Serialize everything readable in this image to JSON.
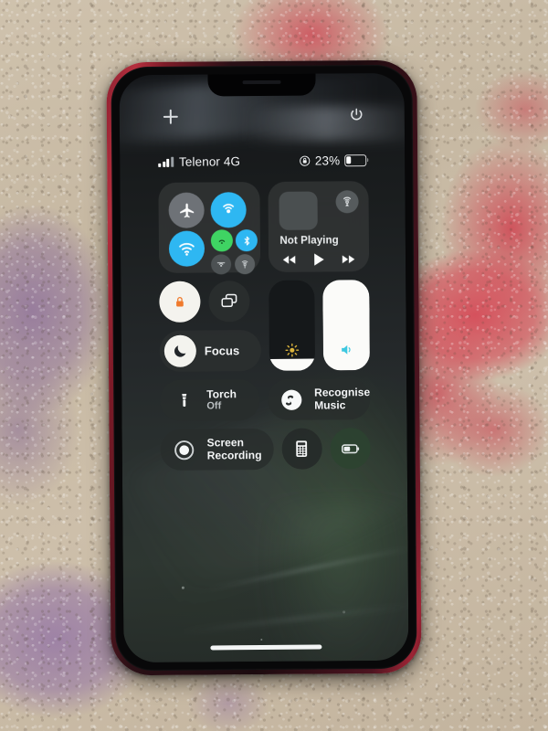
{
  "scene": {
    "description": "Photograph of a red iPhone lying on a patterned carpet, screen showing iOS Control Center",
    "carpet_colors": [
      "#cfc2ad",
      "#c6b8a2",
      "#d64856",
      "#967aa2"
    ],
    "phone_frame_color": "#b52f3e"
  },
  "status_bar": {
    "carrier": "Telenor 4G",
    "signal_bars": 3,
    "signal_bars_total": 4,
    "battery_percent_label": "23%",
    "battery_percent_value": 23,
    "battery_icon": "battery-icon",
    "orientation_lock_icon": "rotation-lock-status-icon"
  },
  "top_icons": {
    "left_icon": "plus-icon",
    "right_icon": "power-icon"
  },
  "control_center": {
    "connectivity": {
      "module_name": "connectivity-module",
      "buttons": [
        {
          "name": "airplane-mode-icon",
          "label": "Airplane Mode",
          "state": "off",
          "color": "#6e7277"
        },
        {
          "name": "cellular-data-icon",
          "label": "Cellular Data",
          "state": "on",
          "color": "#2eb7f2"
        },
        {
          "name": "wifi-icon",
          "label": "Wi-Fi",
          "state": "on",
          "color": "#2eb7f2"
        },
        {
          "name": "airdrop-icon",
          "label": "AirDrop",
          "state": "on",
          "color": "#3fd463"
        },
        {
          "name": "bluetooth-icon",
          "label": "Bluetooth",
          "state": "on",
          "color": "#2eb7f2"
        },
        {
          "name": "personal-hotspot-icon",
          "label": "Personal Hotspot",
          "state": "off",
          "color": "#4c5153"
        },
        {
          "name": "satellite-icon",
          "label": "Satellite",
          "state": "off",
          "color": "#5a5f61"
        }
      ]
    },
    "media": {
      "module_name": "now-playing-module",
      "title": "Not Playing",
      "airplay_icon": "airplay-icon",
      "album_art": "album-art-placeholder",
      "controls": [
        "rewind-icon",
        "play-icon",
        "fast-forward-icon"
      ]
    },
    "rotation_lock": {
      "name": "rotation-lock-button",
      "label": "Rotation Lock",
      "state": "on",
      "icon": "lock-icon",
      "icon_color": "#f07a2c"
    },
    "screen_mirroring": {
      "name": "screen-mirroring-button",
      "label": "Screen Mirroring",
      "state": "off",
      "icon": "screen-mirroring-icon"
    },
    "focus": {
      "name": "focus-button",
      "label": "Focus",
      "icon": "moon-icon",
      "state": "off"
    },
    "brightness": {
      "name": "brightness-slider",
      "label": "Display Brightness",
      "value_percent": 13,
      "icon": "brightness-sun-icon",
      "icon_color": "#e8c14a"
    },
    "volume": {
      "name": "volume-slider",
      "label": "Volume",
      "value_percent": 100,
      "icon": "speaker-icon",
      "icon_color": "#3ec8e0"
    },
    "torch": {
      "name": "torch-button",
      "title": "Torch",
      "subtitle": "Off",
      "icon": "flashlight-icon"
    },
    "recognise_music": {
      "name": "recognise-music-button",
      "title_line1": "Recognise",
      "title_line2": "Music",
      "icon": "shazam-icon"
    },
    "screen_recording": {
      "name": "screen-recording-button",
      "title_line1": "Screen",
      "title_line2": "Recording",
      "icon": "record-icon"
    },
    "calculator": {
      "name": "calculator-button",
      "label": "Calculator",
      "icon": "calculator-icon"
    },
    "low_power_mode": {
      "name": "low-power-mode-button",
      "label": "Low Power Mode",
      "icon": "battery-lowpower-icon",
      "state": "on"
    }
  },
  "home_indicator": {
    "name": "home-indicator"
  }
}
